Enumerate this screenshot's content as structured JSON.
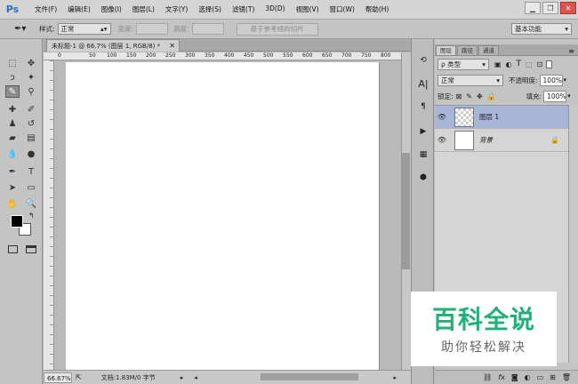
{
  "app": {
    "logo": "Ps"
  },
  "menu": [
    "文件(F)",
    "编辑(E)",
    "图像(I)",
    "图层(L)",
    "文字(Y)",
    "选择(S)",
    "滤镜(T)",
    "3D(D)",
    "视图(V)",
    "窗口(W)",
    "帮助(H)"
  ],
  "window_controls": {
    "minimize": "▁",
    "restore": "❐",
    "close": "✕"
  },
  "options": {
    "style_label": "样式:",
    "style_value": "正常",
    "width_label": "宽度:",
    "height_label": "高度:",
    "slice_button": "基于参考线的切片",
    "workspace": "基本功能"
  },
  "document": {
    "tab_title": "未标题-1 @ 66.7% (图层 1, RGB/8) *",
    "close": "✕",
    "ruler_ticks": [
      "0",
      "50",
      "100",
      "150",
      "200",
      "250",
      "300",
      "350",
      "400",
      "450",
      "500",
      "550",
      "600",
      "650",
      "700",
      "750",
      "800"
    ],
    "zoom": "66.67%",
    "doc_info": "文档:1.83M/0 字节"
  },
  "layers_panel": {
    "tabs": [
      "图层",
      "路径",
      "通道"
    ],
    "filter_value": "ρ 类型",
    "blend_mode": "正常",
    "opacity_label": "不透明度:",
    "opacity_value": "100%",
    "lock_label": "锁定:",
    "fill_label": "填充:",
    "fill_value": "100%",
    "layers": [
      {
        "name": "图层 1",
        "selected": true
      },
      {
        "name": "背景",
        "selected": false
      }
    ]
  },
  "watermark": {
    "title": "百科全说",
    "subtitle": "助你轻松解决"
  },
  "colors": {
    "accent": "#2c6fb6",
    "selected_layer": "#a7b6d6",
    "watermark_green": "#22b07a"
  }
}
